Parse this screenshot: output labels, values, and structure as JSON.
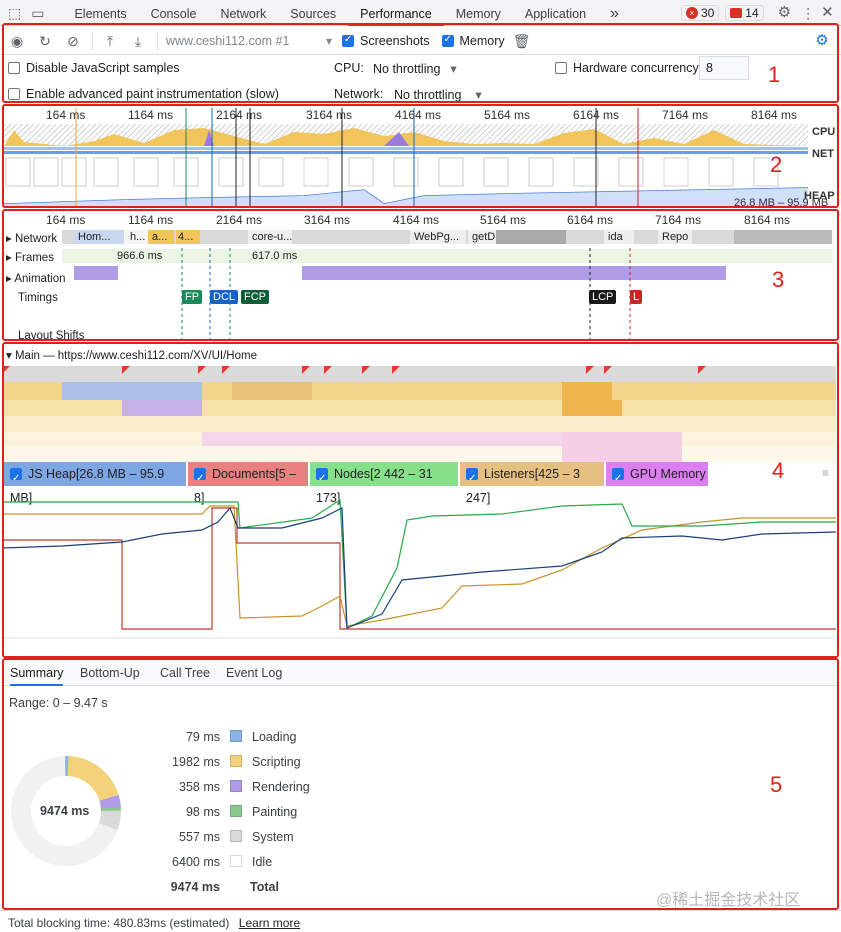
{
  "tabs": {
    "items": [
      "Elements",
      "Console",
      "Network",
      "Sources",
      "Performance",
      "Memory",
      "Application"
    ],
    "more": "»",
    "errors": "30",
    "warnings": "14"
  },
  "toolbar": {
    "url": "www.ceshi112.com #1",
    "screenshots_label": "Screenshots",
    "memory_label": "Memory"
  },
  "settings": {
    "disable_js": "Disable JavaScript samples",
    "adv_paint": "Enable advanced paint instrumentation (slow)",
    "cpu_label": "CPU:",
    "cpu_value": "No throttling",
    "network_label": "Network:",
    "network_value": "No throttling",
    "hw_label": "Hardware concurrency",
    "hw_value": "8"
  },
  "overview": {
    "ticks": [
      "164 ms",
      "1164 ms",
      "2164 ms",
      "3164 ms",
      "4164 ms",
      "5164 ms",
      "6164 ms",
      "7164 ms",
      "8164 ms"
    ],
    "labels": {
      "cpu": "CPU",
      "net": "NET",
      "heap": "HEAP"
    },
    "heap_range": "26.8 MB – 95.9 MB"
  },
  "timeline": {
    "ticks": [
      "164 ms",
      "1164 ms",
      "2164 ms",
      "3164 ms",
      "4164 ms",
      "5164 ms",
      "6164 ms",
      "7164 ms",
      "8164 ms"
    ],
    "network_label": "Network",
    "frames_label": "Frames",
    "animation_label": "Animation",
    "timings_label": "Timings",
    "layout_label": "Layout Shifts",
    "network_items": [
      "Hom...",
      "h...",
      "a...",
      "4...",
      "core-u...",
      "WebPg...",
      "getD",
      "ida",
      "Repo"
    ],
    "frame_times": [
      "966.6 ms",
      "617.0 ms"
    ],
    "markers": {
      "fp": "FP",
      "dcl": "DCL",
      "fcp": "FCP",
      "lcp": "LCP",
      "l": "L"
    }
  },
  "main": {
    "label": "Main — https://www.ceshi112.com/XV/UI/Home"
  },
  "legend": {
    "js_heap": "JS Heap[26.8 MB – 95.9 MB]",
    "documents": "Documents[5 – 8]",
    "nodes": "Nodes[2 442 – 31 173]",
    "listeners": "Listeners[425 – 3 247]",
    "gpu": "GPU Memory"
  },
  "bottom": {
    "tabs": [
      "Summary",
      "Bottom-Up",
      "Call Tree",
      "Event Log"
    ],
    "range": "Range: 0 – 9.47 s",
    "total_center": "9474 ms",
    "rows": [
      {
        "value": "79 ms",
        "label": "Loading",
        "color": "#8ab4e8"
      },
      {
        "value": "1982 ms",
        "label": "Scripting",
        "color": "#f4d27a"
      },
      {
        "value": "358 ms",
        "label": "Rendering",
        "color": "#af9be8"
      },
      {
        "value": "98 ms",
        "label": "Painting",
        "color": "#8cc88b"
      },
      {
        "value": "557 ms",
        "label": "System",
        "color": "#dadada"
      },
      {
        "value": "6400 ms",
        "label": "Idle",
        "color": "#ffffff"
      }
    ],
    "total_value": "9474 ms",
    "total_label": "Total"
  },
  "footer": {
    "blocking": "Total blocking time: 480.83ms (estimated)",
    "learn": "Learn more"
  },
  "watermark": "@稀土掘金技术社区",
  "annotations": [
    "1",
    "2",
    "3",
    "4",
    "5"
  ]
}
